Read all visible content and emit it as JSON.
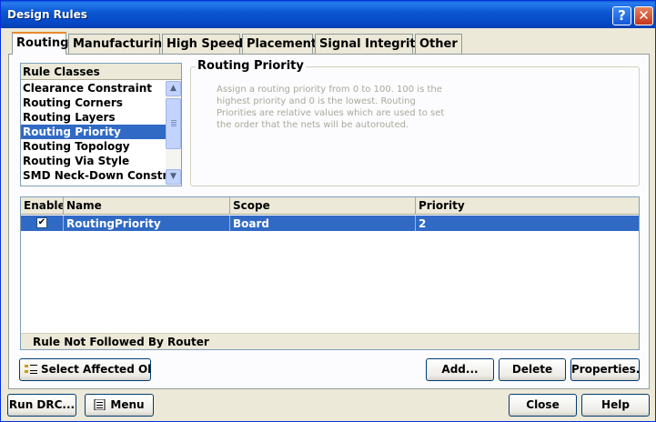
{
  "window": {
    "title": "Design Rules"
  },
  "titlebar": {
    "help_glyph": "?",
    "close_glyph": "✕"
  },
  "tabs": [
    {
      "label": "Routing",
      "active": true
    },
    {
      "label": "Manufacturing",
      "active": false
    },
    {
      "label": "High Speed",
      "active": false
    },
    {
      "label": "Placement",
      "active": false
    },
    {
      "label": "Signal Integrity",
      "active": false
    },
    {
      "label": "Other",
      "active": false
    }
  ],
  "rule_classes": {
    "header": "Rule Classes",
    "items": [
      "Clearance Constraint",
      "Routing Corners",
      "Routing Layers",
      "Routing Priority",
      "Routing Topology",
      "Routing Via Style",
      "SMD Neck-Down Constrai"
    ],
    "selected_index": 3
  },
  "group": {
    "title": "Routing Priority",
    "description": "Assign a routing priority from 0 to 100. 100 is the highest priority and 0 is the lowest. Routing Priorities are relative values which are used to set the order that the nets will be autorouted."
  },
  "table": {
    "columns": [
      "Enable",
      "Name",
      "Scope",
      "Priority"
    ],
    "rows": [
      {
        "enabled": true,
        "name": "RoutingPriority",
        "scope": "Board",
        "priority": "2"
      }
    ],
    "status": "Rule Not Followed By Router"
  },
  "buttons": {
    "select_affected": "Select Affected Obj",
    "add": "Add...",
    "delete": "Delete",
    "properties": "Properties...",
    "run_drc": "Run DRC...",
    "menu": "Menu",
    "close": "Close",
    "help": "Help"
  },
  "colors": {
    "title_bar": "#0b58d3",
    "selection": "#316ac5",
    "active_tab_accent": "#e68b2c",
    "dialog_face": "#ece9d8"
  }
}
